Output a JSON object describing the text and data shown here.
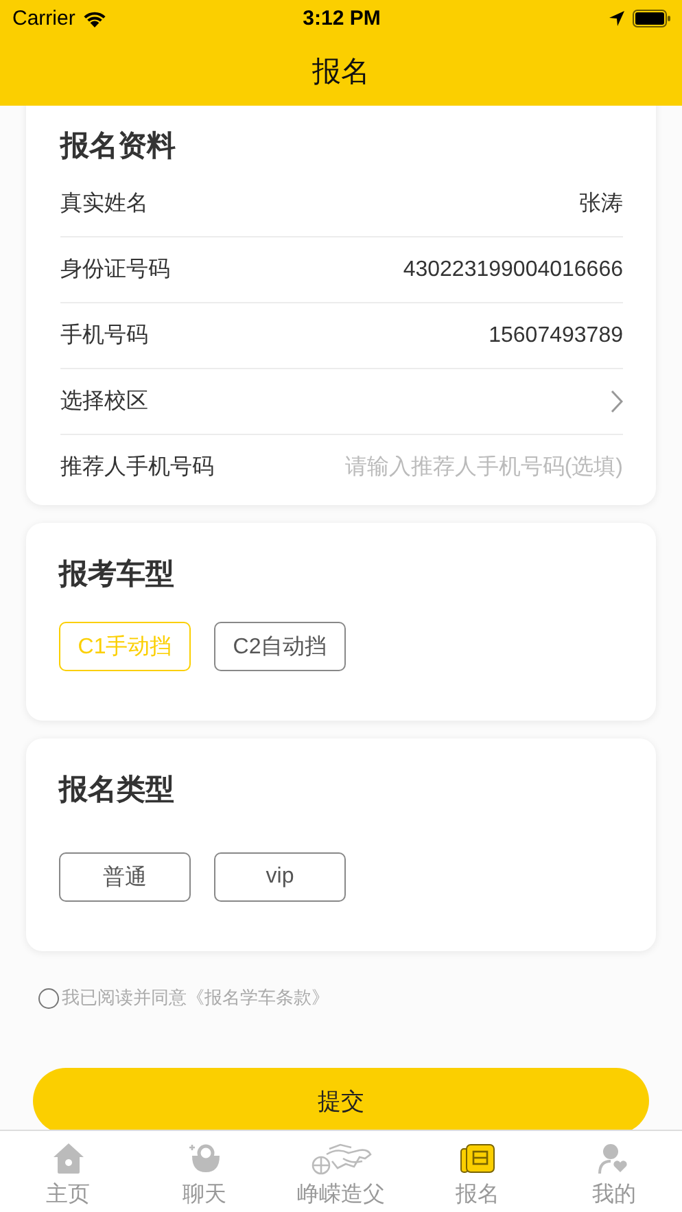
{
  "status_bar": {
    "carrier": "Carrier",
    "time": "3:12 PM"
  },
  "nav": {
    "title": "报名"
  },
  "profile": {
    "title": "报名资料",
    "rows": [
      {
        "kind": "value",
        "label": "真实姓名",
        "value": "张涛"
      },
      {
        "kind": "value",
        "label": "身份证号码",
        "value": "430223199004016666"
      },
      {
        "kind": "value",
        "label": "手机号码",
        "value": "15607493789"
      },
      {
        "kind": "picker",
        "label": "选择校区"
      },
      {
        "kind": "input",
        "label": "推荐人手机号码",
        "placeholder": "请输入推荐人手机号码(选填)"
      }
    ]
  },
  "car_type": {
    "title": "报考车型",
    "options": [
      {
        "label": "C1手动挡",
        "selected": true
      },
      {
        "label": "C2自动挡",
        "selected": false
      }
    ]
  },
  "signup_type": {
    "title": "报名类型",
    "options": [
      {
        "label": "普通",
        "selected": false
      },
      {
        "label": "vip",
        "selected": false
      }
    ]
  },
  "agreement": {
    "checked": false,
    "text": "我已阅读并同意《报名学车条款》"
  },
  "submit": {
    "label": "提交"
  },
  "tabs": [
    {
      "kind": "home",
      "label": "主页",
      "selected": false
    },
    {
      "kind": "chat",
      "label": "聊天",
      "selected": false
    },
    {
      "kind": "logo",
      "label": "峥嵘造父",
      "selected": false
    },
    {
      "kind": "signup",
      "label": "报名",
      "selected": true
    },
    {
      "kind": "me",
      "label": "我的",
      "selected": false
    }
  ]
}
